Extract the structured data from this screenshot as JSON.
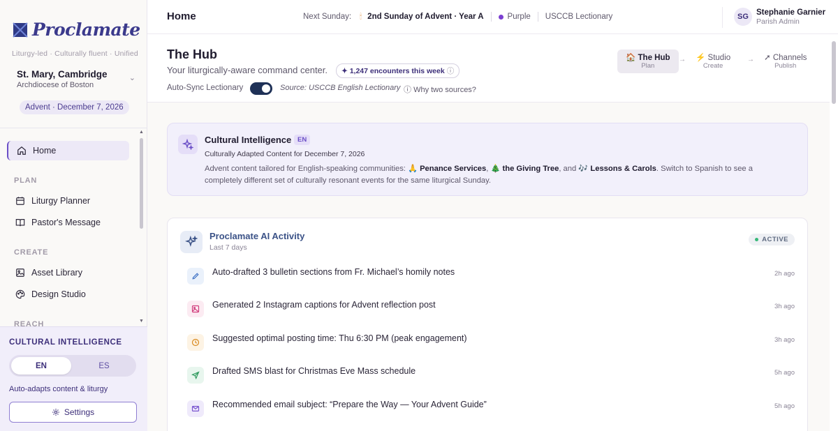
{
  "sidebar": {
    "logo": "Proclamate",
    "tagline": "Liturgy-led · Culturally fluent · Unified",
    "parish_name": "St. Mary, Cambridge",
    "parish_sub": "Archdiocese of Boston",
    "season": "Advent · December 7, 2026",
    "nav": {
      "home": "Home",
      "plan_section": "PLAN",
      "liturgy_planner": "Liturgy Planner",
      "pastors_message": "Pastor's Message",
      "create_section": "CREATE",
      "asset_library": "Asset Library",
      "design_studio": "Design Studio",
      "reach_section": "REACH"
    },
    "ci": {
      "title": "CULTURAL INTELLIGENCE",
      "lang_en": "EN",
      "lang_es": "ES",
      "selected": "EN",
      "note": "Auto-adapts content & liturgy",
      "settings": "Settings"
    }
  },
  "topbar": {
    "title": "Home",
    "next_sunday_label": "Next Sunday:",
    "next_sunday": "2nd Sunday of Advent · Year A",
    "color_name": "Purple",
    "color_hex": "#7b3fd1",
    "lectionary": "USCCB Lectionary",
    "user_initials": "SG",
    "user_name": "Stephanie Garnier",
    "user_role": "Parish Admin"
  },
  "hub": {
    "title": "The Hub",
    "subtitle": "Your liturgically-aware command center.",
    "encounters": "✦ 1,247 encounters this week",
    "sync_label": "Auto-Sync Lectionary",
    "sync_on": true,
    "source": "Source: USCCB English Lectionary",
    "why": "Why two sources?",
    "steps": [
      {
        "label": "The Hub",
        "sub": "Plan"
      },
      {
        "label": "Studio",
        "sub": "Create"
      },
      {
        "label": "Channels",
        "sub": "Publish"
      }
    ]
  },
  "ci_card": {
    "title": "Cultural Intelligence",
    "badge": "EN",
    "subtitle": "Culturally Adapted Content for December 7, 2026",
    "body_prefix": "Advent content tailored for English-speaking communities:",
    "event1": "Penance Services",
    "event2": "the Giving Tree",
    "and": ", and",
    "event3": "Lessons & Carols",
    "body_suffix": ". Switch to Spanish to see a completely different set of culturally resonant events for the same liturgical Sunday."
  },
  "activity": {
    "title": "Proclamate AI Activity",
    "subtitle": "Last 7 days",
    "status": "ACTIVE",
    "items": [
      {
        "text": "Auto-drafted 3 bulletin sections from Fr. Michael’s homily notes",
        "time": "2h ago",
        "icon": "pencil-icon"
      },
      {
        "text": "Generated 2 Instagram captions for Advent reflection post",
        "time": "3h ago",
        "icon": "image-icon"
      },
      {
        "text": "Suggested optimal posting time: Thu 6:30 PM (peak engagement)",
        "time": "3h ago",
        "icon": "clock-icon"
      },
      {
        "text": "Drafted SMS blast for Christmas Eve Mass schedule",
        "time": "5h ago",
        "icon": "send-icon"
      },
      {
        "text": "Recommended email subject: “Prepare the Way — Your Advent Guide”",
        "time": "5h ago",
        "icon": "mail-icon"
      }
    ]
  }
}
